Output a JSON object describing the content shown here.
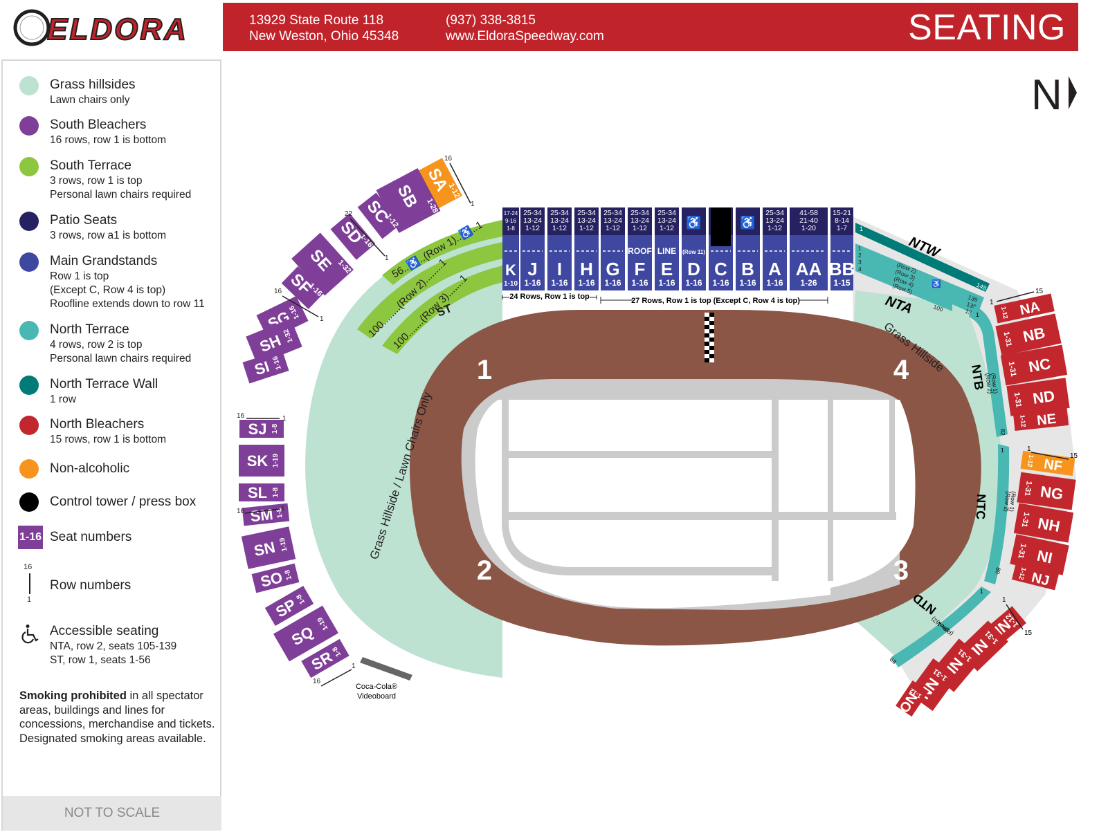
{
  "header": {
    "logo_text": "ELDORA",
    "address_line1": "13929 State Route 118",
    "address_line2": "New Weston, Ohio 45348",
    "phone": "(937) 338-3815",
    "website": "www.EldoraSpeedway.com",
    "title": "SEATING"
  },
  "compass": {
    "label": "N"
  },
  "colors": {
    "brand_red": "#c1232b",
    "grass": "#bde2d2",
    "south_bleachers": "#7f3f98",
    "south_terrace": "#8dc63f",
    "patio": "#262262",
    "grandstand": "#3f48a0",
    "north_terrace": "#4ab8b2",
    "north_terrace_wall": "#007b78",
    "north_bleachers": "#c1272d",
    "non_alcoholic": "#f7941d",
    "control_tower": "#000000",
    "track": "#8b5646",
    "apron": "#cbcbcb"
  },
  "legend": {
    "items": [
      {
        "title": "Grass hillsides",
        "desc": [
          "Lawn chairs only"
        ]
      },
      {
        "title": "South Bleachers",
        "desc": [
          "16 rows, row 1 is bottom"
        ]
      },
      {
        "title": "South Terrace",
        "desc": [
          "3 rows, row 1 is top",
          "Personal lawn chairs required"
        ]
      },
      {
        "title": "Patio Seats",
        "desc": [
          "3 rows, row a1 is bottom"
        ]
      },
      {
        "title": "Main Grandstands",
        "desc": [
          "Row 1 is top",
          "(Except C, Row 4 is top)",
          "Roofline extends down to row 11"
        ]
      },
      {
        "title": "North Terrace",
        "desc": [
          "4 rows, row 2 is top",
          "Personal lawn chairs required"
        ]
      },
      {
        "title": "North Terrace Wall",
        "desc": [
          "1 row"
        ]
      },
      {
        "title": "North Bleachers",
        "desc": [
          "15 rows, row 1 is bottom"
        ]
      },
      {
        "title": "Non-alcoholic",
        "desc": []
      },
      {
        "title": "Control tower / press box",
        "desc": []
      }
    ],
    "seat_numbers": {
      "badge": "1-16",
      "title": "Seat numbers"
    },
    "row_numbers": {
      "top": "16",
      "bottom": "1",
      "title": "Row numbers"
    },
    "accessible": {
      "title": "Accessible seating",
      "desc": [
        "NTA, row 2, seats 105-139",
        "ST, row 1, seats 1-56"
      ]
    },
    "smoking": {
      "bold": "Smoking prohibited",
      "rest": " in all spectator areas, buildings and lines for concessions, merchandise and tickets. Designated smoking areas available."
    },
    "not_to_scale": "NOT TO SCALE"
  },
  "grandstands": {
    "sections": [
      {
        "name": "K",
        "seats": "1-10",
        "patio": [
          "17-24",
          "9-16",
          "1-8"
        ]
      },
      {
        "name": "J",
        "seats": "1-16",
        "patio": [
          "25-34",
          "13-24",
          "1-12"
        ]
      },
      {
        "name": "I",
        "seats": "1-16",
        "patio": [
          "25-34",
          "13-24",
          "1-12"
        ]
      },
      {
        "name": "H",
        "seats": "1-16",
        "patio": [
          "25-34",
          "13-24",
          "1-12"
        ]
      },
      {
        "name": "G",
        "seats": "1-16",
        "patio": [
          "25-34",
          "13-24",
          "1-12"
        ]
      },
      {
        "name": "F",
        "seats": "1-16",
        "patio": [
          "25-34",
          "13-24",
          "1-12"
        ],
        "note": "ROOF"
      },
      {
        "name": "E",
        "seats": "1-16",
        "patio": [
          "25-34",
          "13-24",
          "1-12"
        ],
        "note": "LINE"
      },
      {
        "name": "D",
        "seats": "1-16",
        "patio": [
          "accessible"
        ],
        "note": "(Row 11)"
      },
      {
        "name": "C",
        "seats": "1-16",
        "patio": [
          "tower"
        ]
      },
      {
        "name": "B",
        "seats": "1-16",
        "patio": [
          "accessible"
        ]
      },
      {
        "name": "A",
        "seats": "1-16",
        "patio": [
          "25-34",
          "13-24",
          "1-12"
        ]
      },
      {
        "name": "AA",
        "seats": "1-26",
        "patio": [
          "41-58",
          "21-40",
          "1-20"
        ]
      },
      {
        "name": "BB",
        "seats": "1-15",
        "patio": [
          "15-21",
          "8-14",
          "1-7"
        ]
      }
    ],
    "note_left": "24 Rows, Row 1 is top",
    "note_right": "27 Rows, Row 1 is top (Except C, Row 4 is top)"
  },
  "south_terrace": {
    "label": "ST",
    "rows": [
      {
        "start": "56",
        "label": "(Row 1)",
        "end": "1"
      },
      {
        "start": "100",
        "label": "(Row 2)",
        "end": "1"
      },
      {
        "start": "100",
        "label": "(Row 3)",
        "end": "1"
      }
    ]
  },
  "south_bleachers": [
    {
      "name": "SA",
      "seats": "1-12",
      "nonalcoholic": true
    },
    {
      "name": "SB",
      "seats": "1-28"
    },
    {
      "name": "SC",
      "seats": "1-12"
    },
    {
      "name": "SD",
      "seats": "1-16"
    },
    {
      "name": "SE",
      "seats": "1-32"
    },
    {
      "name": "SF",
      "seats": "1-16"
    },
    {
      "name": "SG",
      "seats": "1-16"
    },
    {
      "name": "SH",
      "seats": "1-32"
    },
    {
      "name": "SI",
      "seats": "1-16"
    },
    {
      "name": "SJ",
      "seats": "1-8"
    },
    {
      "name": "SK",
      "seats": "1-19"
    },
    {
      "name": "SL",
      "seats": "1-8"
    },
    {
      "name": "SM",
      "seats": "1-8"
    },
    {
      "name": "SN",
      "seats": "1-19"
    },
    {
      "name": "SO",
      "seats": "1-8"
    },
    {
      "name": "SP",
      "seats": "1-8"
    },
    {
      "name": "SQ",
      "seats": "1-19"
    },
    {
      "name": "SR",
      "seats": "1-8"
    }
  ],
  "south_row_markers": {
    "sa": [
      "16",
      "1"
    ],
    "sd": [
      "22",
      "1"
    ],
    "sg": [
      "16",
      "1"
    ],
    "sj": [
      "16",
      "1"
    ],
    "sm": [
      "16",
      "1"
    ],
    "sr": [
      "16",
      "1"
    ]
  },
  "north_bleachers": [
    {
      "name": "NA",
      "seats": "1-12"
    },
    {
      "name": "NB",
      "seats": "1-31"
    },
    {
      "name": "NC",
      "seats": "1-31"
    },
    {
      "name": "ND",
      "seats": "1-31"
    },
    {
      "name": "NE",
      "seats": "1-12"
    },
    {
      "name": "NF",
      "seats": "1-12",
      "nonalcoholic": true
    },
    {
      "name": "NG",
      "seats": "1-31"
    },
    {
      "name": "NH",
      "seats": "1-31"
    },
    {
      "name": "NI",
      "seats": "1-31"
    },
    {
      "name": "NJ",
      "seats": "1-12"
    },
    {
      "name": "NK",
      "seats": "1-12"
    },
    {
      "name": "NL",
      "seats": "1-31"
    },
    {
      "name": "NM",
      "seats": "1-31"
    },
    {
      "name": "NN",
      "seats": "1-31"
    },
    {
      "name": "NO",
      "seats": "1-12"
    }
  ],
  "north_row_markers": {
    "top": "15",
    "bottom": "1"
  },
  "north_terrace": {
    "ntw": {
      "label": "NTW",
      "start": "1",
      "end": "148"
    },
    "nta": {
      "label": "NTA",
      "rows": [
        {
          "num": "1",
          "label": "(Row 2)",
          "end": "139"
        },
        {
          "num": "2",
          "label": "(Row 3)",
          "end": "139"
        },
        {
          "num": "3",
          "label": "(Row 4)",
          "end": "139"
        },
        {
          "num": "4",
          "label": "(Row 5)",
          "end": "100"
        }
      ]
    },
    "ntb": {
      "label": "NTB",
      "rows": [
        "(Row 1)",
        "(Row 2)"
      ],
      "start": "1",
      "end": "82"
    },
    "ntc": {
      "label": "NTC",
      "rows": [
        "(Row 1)",
        "(Row 2)"
      ],
      "start": "1",
      "end": "80"
    },
    "ntd": {
      "label": "NTD",
      "rows": [
        "(Row 1)",
        "(Row 2)"
      ],
      "start": "1",
      "end": "89"
    }
  },
  "map_labels": {
    "grass_south": "Grass Hillside / Lawn Chairs Only",
    "grass_north": "Grass Hillside",
    "turns": [
      "1",
      "2",
      "3",
      "4"
    ],
    "videoboard_line1": "Coca-Cola®",
    "videoboard_line2": "Videoboard"
  }
}
